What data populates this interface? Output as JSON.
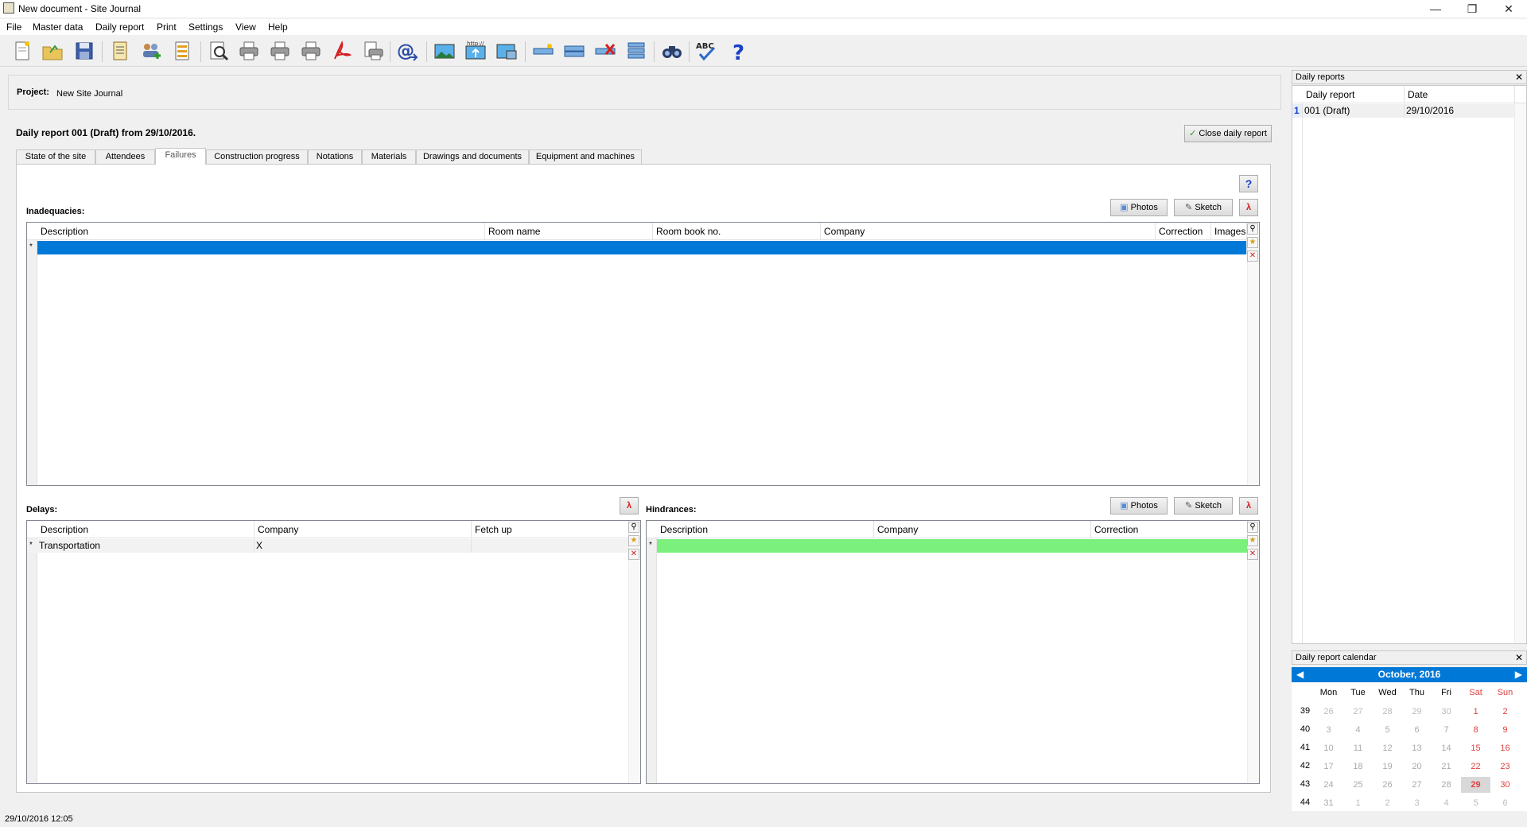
{
  "window": {
    "title": "New document - Site Journal"
  },
  "menu": [
    "File",
    "Master data",
    "Daily report",
    "Print",
    "Settings",
    "View",
    "Help"
  ],
  "toolbar": [
    "new-document-icon",
    "open-folder-icon",
    "save-icon",
    "report-icon",
    "add-users-icon",
    "list-icon",
    "preview-icon",
    "print-icon",
    "print-2-icon",
    "print-3-icon",
    "pdf-icon",
    "print-preview-icon",
    "email-icon",
    "image-icon",
    "web-upload-icon",
    "image-export-icon",
    "add-row-icon",
    "edit-row-icon",
    "delete-row-icon",
    "multi-row-icon",
    "find-icon",
    "spellcheck-icon",
    "help-icon"
  ],
  "project": {
    "label": "Project:",
    "value": "New Site Journal"
  },
  "report": {
    "heading": "Daily report 001 (Draft) from 29/10/2016.",
    "close_button": "Close daily report"
  },
  "tabs": [
    "State of the site",
    "Attendees",
    "Failures",
    "Construction progress",
    "Notations",
    "Materials",
    "Drawings and documents",
    "Equipment and machines"
  ],
  "active_tab": "Failures",
  "buttons": {
    "photos": "Photos",
    "sketch": "Sketch",
    "help": "?"
  },
  "inadequacies": {
    "label": "Inadequacies:",
    "columns": [
      "Description",
      "Room name",
      "Room book no.",
      "Company",
      "Correction",
      "Images"
    ]
  },
  "delays": {
    "label": "Delays:",
    "columns": [
      "Description",
      "Company",
      "Fetch up"
    ],
    "rows": [
      [
        "Transportation",
        "X",
        ""
      ]
    ]
  },
  "hindrances": {
    "label": "Hindrances:",
    "columns": [
      "Description",
      "Company",
      "Correction"
    ]
  },
  "daily_reports": {
    "title": "Daily reports",
    "columns": [
      "Daily report",
      "Date"
    ],
    "rows": [
      {
        "num": "1",
        "report": "001 (Draft)",
        "date": "29/10/2016"
      }
    ]
  },
  "calendar": {
    "title": "Daily report calendar",
    "month": "October, 2016",
    "days_of_week": [
      "Mon",
      "Tue",
      "Wed",
      "Thu",
      "Fri",
      "Sat",
      "Sun"
    ],
    "weeks": [
      {
        "week": "39",
        "days": [
          "26",
          "27",
          "28",
          "29",
          "30",
          "1",
          "2"
        ]
      },
      {
        "week": "40",
        "days": [
          "3",
          "4",
          "5",
          "6",
          "7",
          "8",
          "9"
        ]
      },
      {
        "week": "41",
        "days": [
          "10",
          "11",
          "12",
          "13",
          "14",
          "15",
          "16"
        ]
      },
      {
        "week": "42",
        "days": [
          "17",
          "18",
          "19",
          "20",
          "21",
          "22",
          "23"
        ]
      },
      {
        "week": "43",
        "days": [
          "24",
          "25",
          "26",
          "27",
          "28",
          "29",
          "30"
        ]
      },
      {
        "week": "44",
        "days": [
          "31",
          "1",
          "2",
          "3",
          "4",
          "5",
          "6"
        ]
      }
    ],
    "selected_day": "29",
    "weekend_color": "#e04040",
    "header_color": "#0078d7"
  },
  "status": {
    "datetime": "29/10/2016 12:05"
  }
}
